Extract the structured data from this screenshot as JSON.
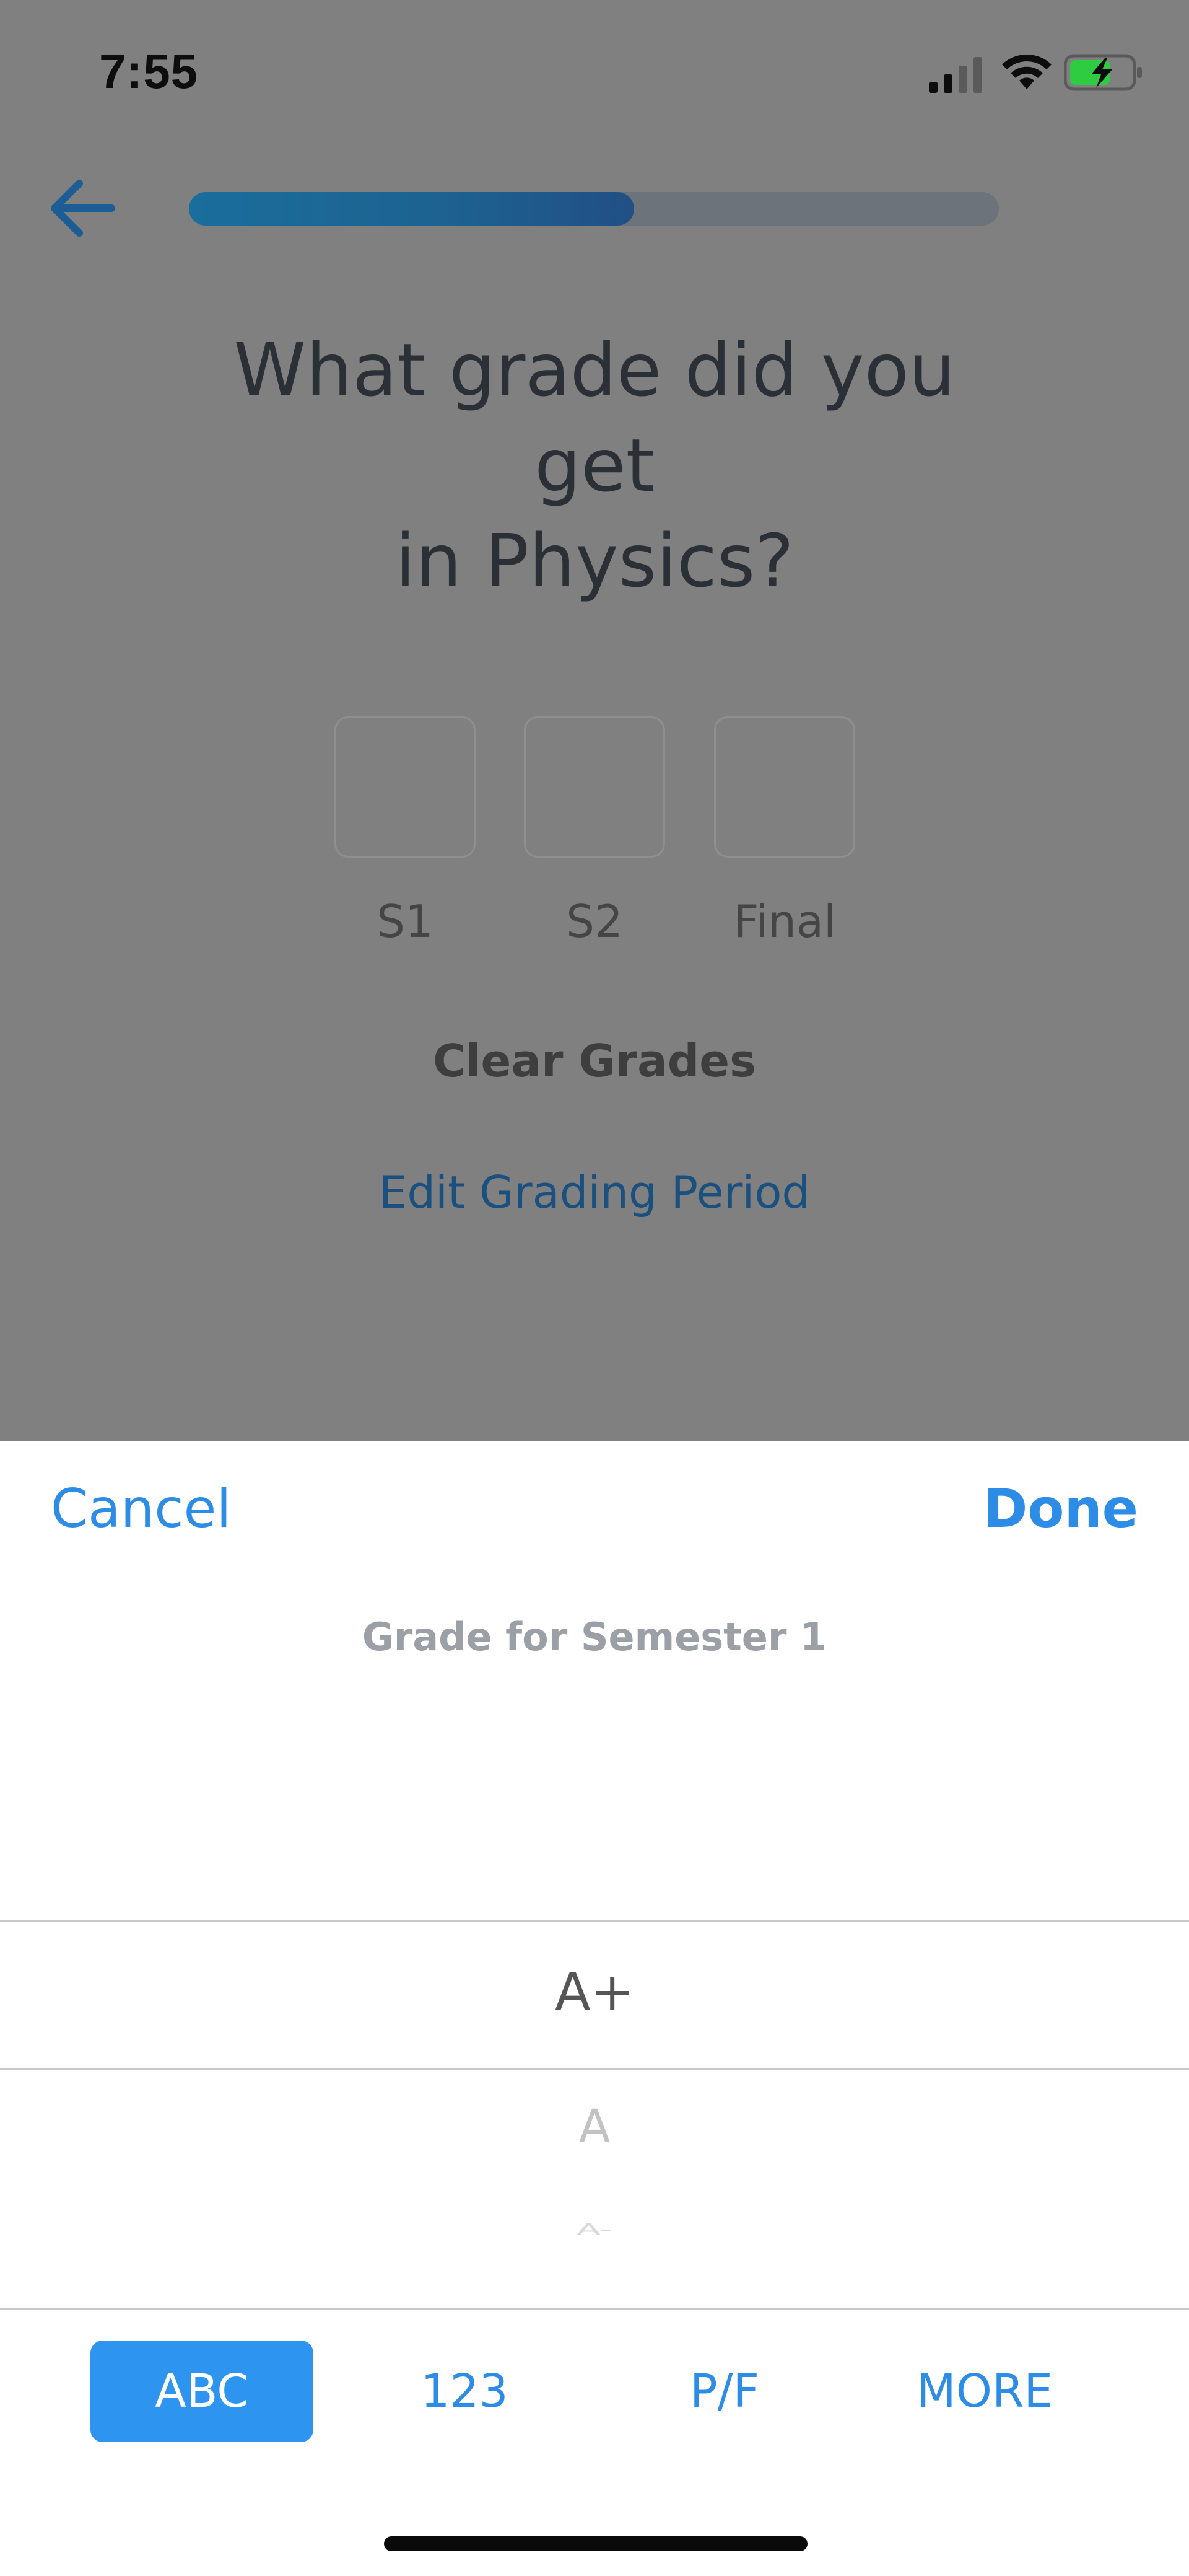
{
  "status_bar": {
    "time": "7:55"
  },
  "header": {
    "progress_percent": 55
  },
  "question": {
    "line1": "What grade did you get",
    "line2": "in Physics?"
  },
  "grade_boxes": [
    {
      "label": "S1"
    },
    {
      "label": "S2"
    },
    {
      "label": "Final"
    }
  ],
  "actions": {
    "clear_grades": "Clear Grades",
    "edit_grading_period": "Edit Grading Period"
  },
  "sheet": {
    "cancel_label": "Cancel",
    "done_label": "Done",
    "picker_title": "Grade for Semester 1",
    "picker_options": [
      "A+",
      "A",
      "A-"
    ],
    "selected": "A+",
    "tabs": [
      "ABC",
      "123",
      "P/F",
      "MORE"
    ],
    "active_tab": "ABC"
  },
  "colors": {
    "accent": "#2d8de6",
    "active_tab": "#2d95f0",
    "overlay": "#808080"
  }
}
